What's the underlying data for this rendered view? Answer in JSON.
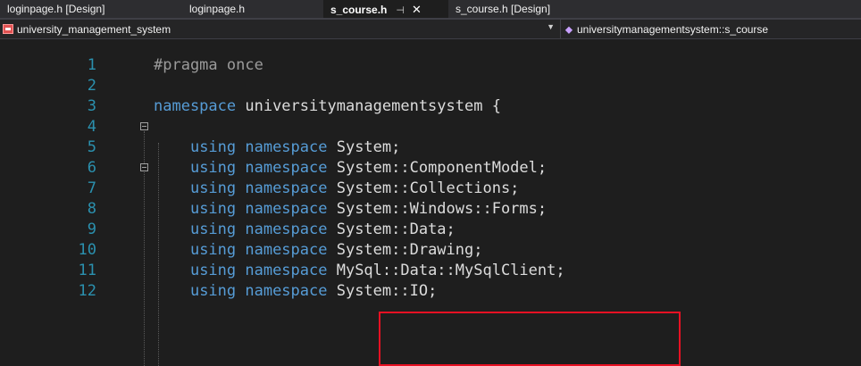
{
  "tabs": [
    {
      "label": "loginpage.h [Design]",
      "active": false
    },
    {
      "label": "loginpage.h",
      "active": false
    },
    {
      "label": "s_course.h",
      "active": true,
      "pin_icon": "pin-icon",
      "close_glyph": "✕"
    },
    {
      "label": "s_course.h [Design]",
      "active": false
    }
  ],
  "nav": {
    "project": "university_management_system",
    "scope": "universitymanagementsystem::s_course"
  },
  "code": {
    "lines": [
      {
        "n": "1",
        "parts": [
          [
            "pp",
            "#pragma once"
          ]
        ]
      },
      {
        "n": "2",
        "parts": []
      },
      {
        "n": "3",
        "parts": [
          [
            "kw",
            "namespace"
          ],
          [
            "",
            " universitymanagementsystem {"
          ]
        ]
      },
      {
        "n": "4",
        "parts": []
      },
      {
        "n": "5",
        "parts": [
          [
            "",
            "    "
          ],
          [
            "kw",
            "using namespace"
          ],
          [
            "",
            " System;"
          ]
        ]
      },
      {
        "n": "6",
        "parts": [
          [
            "",
            "    "
          ],
          [
            "kw",
            "using namespace"
          ],
          [
            "",
            " System::ComponentModel;"
          ]
        ]
      },
      {
        "n": "7",
        "parts": [
          [
            "",
            "    "
          ],
          [
            "kw",
            "using namespace"
          ],
          [
            "",
            " System::Collections;"
          ]
        ]
      },
      {
        "n": "8",
        "parts": [
          [
            "",
            "    "
          ],
          [
            "kw",
            "using namespace"
          ],
          [
            "",
            " System::Windows::Forms;"
          ]
        ]
      },
      {
        "n": "9",
        "parts": [
          [
            "",
            "    "
          ],
          [
            "kw",
            "using namespace"
          ],
          [
            "",
            " System::Data;"
          ]
        ]
      },
      {
        "n": "10",
        "parts": [
          [
            "",
            "    "
          ],
          [
            "kw",
            "using namespace"
          ],
          [
            "",
            " System::Drawing;"
          ]
        ]
      },
      {
        "n": "11",
        "parts": [
          [
            "",
            "    "
          ],
          [
            "kw",
            "using namespace"
          ],
          [
            "",
            " MySql::Data::MySqlClient;"
          ]
        ]
      },
      {
        "n": "12",
        "parts": [
          [
            "",
            "    "
          ],
          [
            "kw",
            "using namespace"
          ],
          [
            "",
            " System::IO;"
          ]
        ]
      }
    ]
  },
  "colors": {
    "keyword": "#569cd6",
    "line_number": "#2b91af",
    "text": "#dcdcdc",
    "highlight": "#e81123"
  }
}
